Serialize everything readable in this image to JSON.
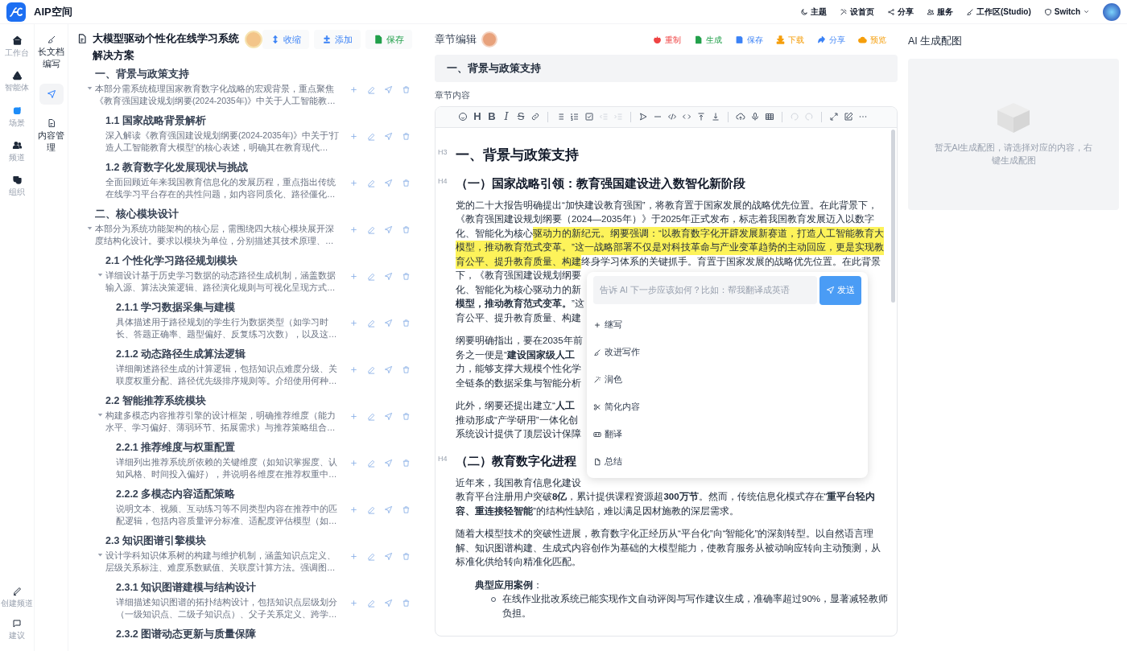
{
  "app": {
    "title": "AIP空间"
  },
  "top_nav": [
    {
      "label": "主题"
    },
    {
      "label": "设首页"
    },
    {
      "label": "分享"
    },
    {
      "label": "服务"
    },
    {
      "label": "工作区(Studio)"
    },
    {
      "label": "Switch",
      "dropdown": true
    }
  ],
  "left_rail": {
    "items": [
      {
        "label": "工作台",
        "selected": false
      },
      {
        "label": "智能体",
        "selected": false
      },
      {
        "label": "场景",
        "selected": true
      },
      {
        "label": "频道",
        "selected": false
      },
      {
        "label": "组织",
        "selected": false
      }
    ],
    "bottom_items": [
      {
        "label": "创建频道"
      },
      {
        "label": "建议"
      }
    ]
  },
  "sub_rail": [
    {
      "label": "长文档编写",
      "selected": false
    },
    {
      "selected": true
    },
    {
      "label": "内容管理",
      "selected": false
    }
  ],
  "outline": {
    "title": "大模型驱动个性化在线学习系统解决方案",
    "buttons": [
      {
        "label": "收缩",
        "color": "#3b82f6"
      },
      {
        "label": "添加",
        "color": "#3b82f6"
      },
      {
        "label": "保存",
        "color": "#22a04b"
      }
    ],
    "nodes": [
      {
        "title": "一、背景与政策支持",
        "description": "本部分需系统梳理国家教育数字化战略的宏观背景，重点聚焦《教育强国建设规划纲要(2024-2035年)》中关于人工智能教…",
        "expanded": true,
        "children": [
          {
            "title": "1.1 国家战略背景解析",
            "description": "深入解读《教育强国建设规划纲要(2024-2035年)》中关于'打造人工智能教育大模型'的核心表述，明确其在教育现代…"
          },
          {
            "title": "1.2 教育数字化发展现状与挑战",
            "description": "全面回顾近年来我国教育信息化的发展历程，重点指出传统在线学习平台存在的共性问题，如内容同质化、路径僵化…"
          }
        ]
      },
      {
        "title": "二、核心模块设计",
        "description": "本部分为系统功能架构的核心层，需围绕四大核心模块展开深度结构化设计。要求以模块为单位，分别描述其技术原理、…",
        "expanded": true,
        "children": [
          {
            "title": "2.1 个性化学习路径规划模块",
            "description": "详细设计基于历史学习数据的动态路径生成机制，涵盖数据输入源、算法决策逻辑、路径演化规则与可视化呈现方式…",
            "expanded": true,
            "children": [
              {
                "title": "2.1.1 学习数据采集与建模",
                "description": "具体描述用于路径规划的学生行为数据类型（如学习时长、答题正确率、题型偏好、反复练习次数），以及这…"
              },
              {
                "title": "2.1.2 动态路径生成算法逻辑",
                "description": "详细阐述路径生成的计算逻辑，包括知识点难度分级、关联度权重分配、路径优先级排序规则等。介绍使用何种…"
              }
            ]
          },
          {
            "title": "2.2 智能推荐系统模块",
            "description": "构建多模态内容推荐引擎的设计框架，明确推荐维度（能力水平、学习偏好、薄弱环节、拓展需求）与推荐策略组合…",
            "expanded": true,
            "children": [
              {
                "title": "2.2.1 推荐维度与权重配置",
                "description": "详细列出推荐系统所依赖的关键维度（如知识掌握度、认知风格、时间投入偏好），并说明各维度在推荐权重中…"
              },
              {
                "title": "2.2.2 多模态内容适配策略",
                "description": "说明文本、视频、互动练习等不同类型内容在推荐中的匹配逻辑，包括内容质量评分标准、适配度评估模型（如…"
              }
            ]
          },
          {
            "title": "2.3 知识图谱引擎模块",
            "description": "设计学科知识体系树的构建与维护机制，涵盖知识点定义、层级关系标注、难度系数赋值、关联度计算方法。强调图…",
            "expanded": true,
            "children": [
              {
                "title": "2.3.1 知识图谱建模与结构设计",
                "description": "详细描述知识图谱的拓扑结构设计，包括知识点层级划分（一级知识点、二级子知识点）、父子关系定义、跨学…"
              },
              {
                "title": "2.3.2 图谱动态更新与质量保障"
              }
            ]
          }
        ]
      }
    ]
  },
  "editor": {
    "title": "章节编辑",
    "actions": [
      {
        "label": "重制",
        "color": "#ef4444"
      },
      {
        "label": "生成",
        "color": "#22a04b"
      },
      {
        "label": "保存",
        "color": "#3b82f6"
      },
      {
        "label": "下载",
        "color": "#f59e0b"
      },
      {
        "label": "分享",
        "color": "#3b82f6"
      },
      {
        "label": "预览",
        "color": "#f59e0b"
      }
    ],
    "section_title": "一、背景与政策支持",
    "content_label": "章节内容",
    "toolbar": [
      [
        {
          "kind": "icon",
          "disabled": false
        },
        {
          "kind": "text",
          "label": "H",
          "disabled": false
        },
        {
          "kind": "text",
          "label": "B",
          "disabled": false
        },
        {
          "kind": "text",
          "label": "I",
          "disabled": false
        },
        {
          "kind": "text",
          "label": "S",
          "disabled": false
        },
        {
          "kind": "icon",
          "disabled": false
        }
      ],
      [
        {
          "kind": "icon",
          "disabled": false
        },
        {
          "kind": "icon",
          "disabled": false
        },
        {
          "kind": "icon",
          "disabled": false
        },
        {
          "kind": "icon",
          "disabled": true
        },
        {
          "kind": "icon",
          "disabled": true
        }
      ],
      [
        {
          "kind": "icon",
          "disabled": false
        },
        {
          "kind": "icon",
          "disabled": false
        },
        {
          "kind": "icon",
          "disabled": false
        },
        {
          "kind": "icon",
          "disabled": false
        },
        {
          "kind": "icon",
          "disabled": false
        },
        {
          "kind": "icon",
          "disabled": false
        }
      ],
      [
        {
          "kind": "icon",
          "disabled": false
        },
        {
          "kind": "icon",
          "disabled": false
        },
        {
          "kind": "icon",
          "disabled": false
        }
      ],
      [
        {
          "kind": "icon",
          "disabled": true
        },
        {
          "kind": "icon",
          "disabled": true
        }
      ],
      [
        {
          "kind": "icon",
          "disabled": false
        },
        {
          "kind": "icon",
          "disabled": false
        },
        {
          "kind": "icon",
          "disabled": false
        }
      ]
    ],
    "blocks": [
      {
        "kind": "h3",
        "marker": "H3",
        "text": "一、背景与政策支持"
      },
      {
        "kind": "h4",
        "marker": "H4",
        "text": "（一）国家战略引领：教育强国建设进入数智化新阶段"
      },
      {
        "kind": "p",
        "lines": [
          "党的二十大报告明确提出“加快建设教育强国”，将教育置于国家发展的战略优先位置。在此背景下，",
          "《教育强国建设规划纲要（2024—2035年）》于2025年正式发布，标志着我国教育发展迈入以数字",
          [
            {
              "text": "化、智能化为核心",
              "highlighted": false
            },
            {
              "text": "驱动力的新纪元。纲要强调：“以教育数字化开辟发展新赛道，打造人工智能教育大",
              "highlighted": true
            }
          ],
          [
            {
              "text": "模型，推动教育范式变革。”这一战略部署不仅是对科技革命与产业变革趋势的主动回应，更是实现教",
              "highlighted": true
            }
          ],
          [
            {
              "text": "育公平、提升教育质量、构建",
              "highlighted": true
            },
            {
              "text": "终身学习体系的关键抓手。育置于国家发展的战略优先位置。在此背景",
              "highlighted": false
            }
          ],
          "下，《教育强国建设规划纲要",
          "化、智能化为核心驱动力的新",
          "**模型，推动教育范式变革。**”这",
          "育公平、提升教育质量、构建"
        ]
      },
      {
        "kind": "p",
        "lines": [
          "纲要明确指出，要在2035年前",
          "务之一便是“**建设国家级人工**",
          "力，能够支撑大规模个性化学",
          "全链条的数据采集与智能分析"
        ]
      },
      {
        "kind": "p",
        "lines": [
          "此外，纲要还提出建立“**人工**",
          "推动形成“产学研用”一体化创",
          "系统设计提供了顶层设计保障"
        ]
      },
      {
        "kind": "h4",
        "marker": "H4",
        "text": "（二）教育数字化进程"
      },
      {
        "kind": "p",
        "lines": [
          "近年来，我国教育信息化建设",
          "教育平台注册用户突破**8亿**，累计提供课程资源超**300万节**。然而，传统信息化模式存在“**重平台轻内**",
          "**容、重连接轻智能**”的结构性缺陷，难以满足因材施教的深层需求。"
        ]
      },
      {
        "kind": "p",
        "lines": [
          "随着大模型技术的突破性进展，教育数字化正经历从“平台化”向“智能化”的深刻转型。以自然语言理",
          "解、知识图谱构建、生成式内容创作为基础的大模型能力，使教育服务从被动响应转向主动预测，从",
          "标准化供给转向精准化匹配。"
        ]
      },
      {
        "kind": "list",
        "items": [
          {
            "text": "**典型应用案例**：",
            "children": [
              {
                "lines": [
                  "在线作业批改系统已能实现作文自动评阅与写作建议生成，准确率超过90%，显著减轻教师",
                  "负担。"
                ]
              }
            ]
          }
        ]
      }
    ],
    "ai_menu": {
      "placeholder": "告诉 AI 下一步应该如何？比如：帮我翻译成英语",
      "send": "发送",
      "items": [
        {
          "label": "继写"
        },
        {
          "label": "改进写作"
        },
        {
          "label": "润色"
        },
        {
          "label": "简化内容"
        },
        {
          "label": "翻译"
        },
        {
          "label": "总结"
        }
      ]
    }
  },
  "image_panel": {
    "title": "AI 生成配图",
    "empty_text": "暂无AI生成配图，请选择对应的内容，右键生成配图"
  }
}
